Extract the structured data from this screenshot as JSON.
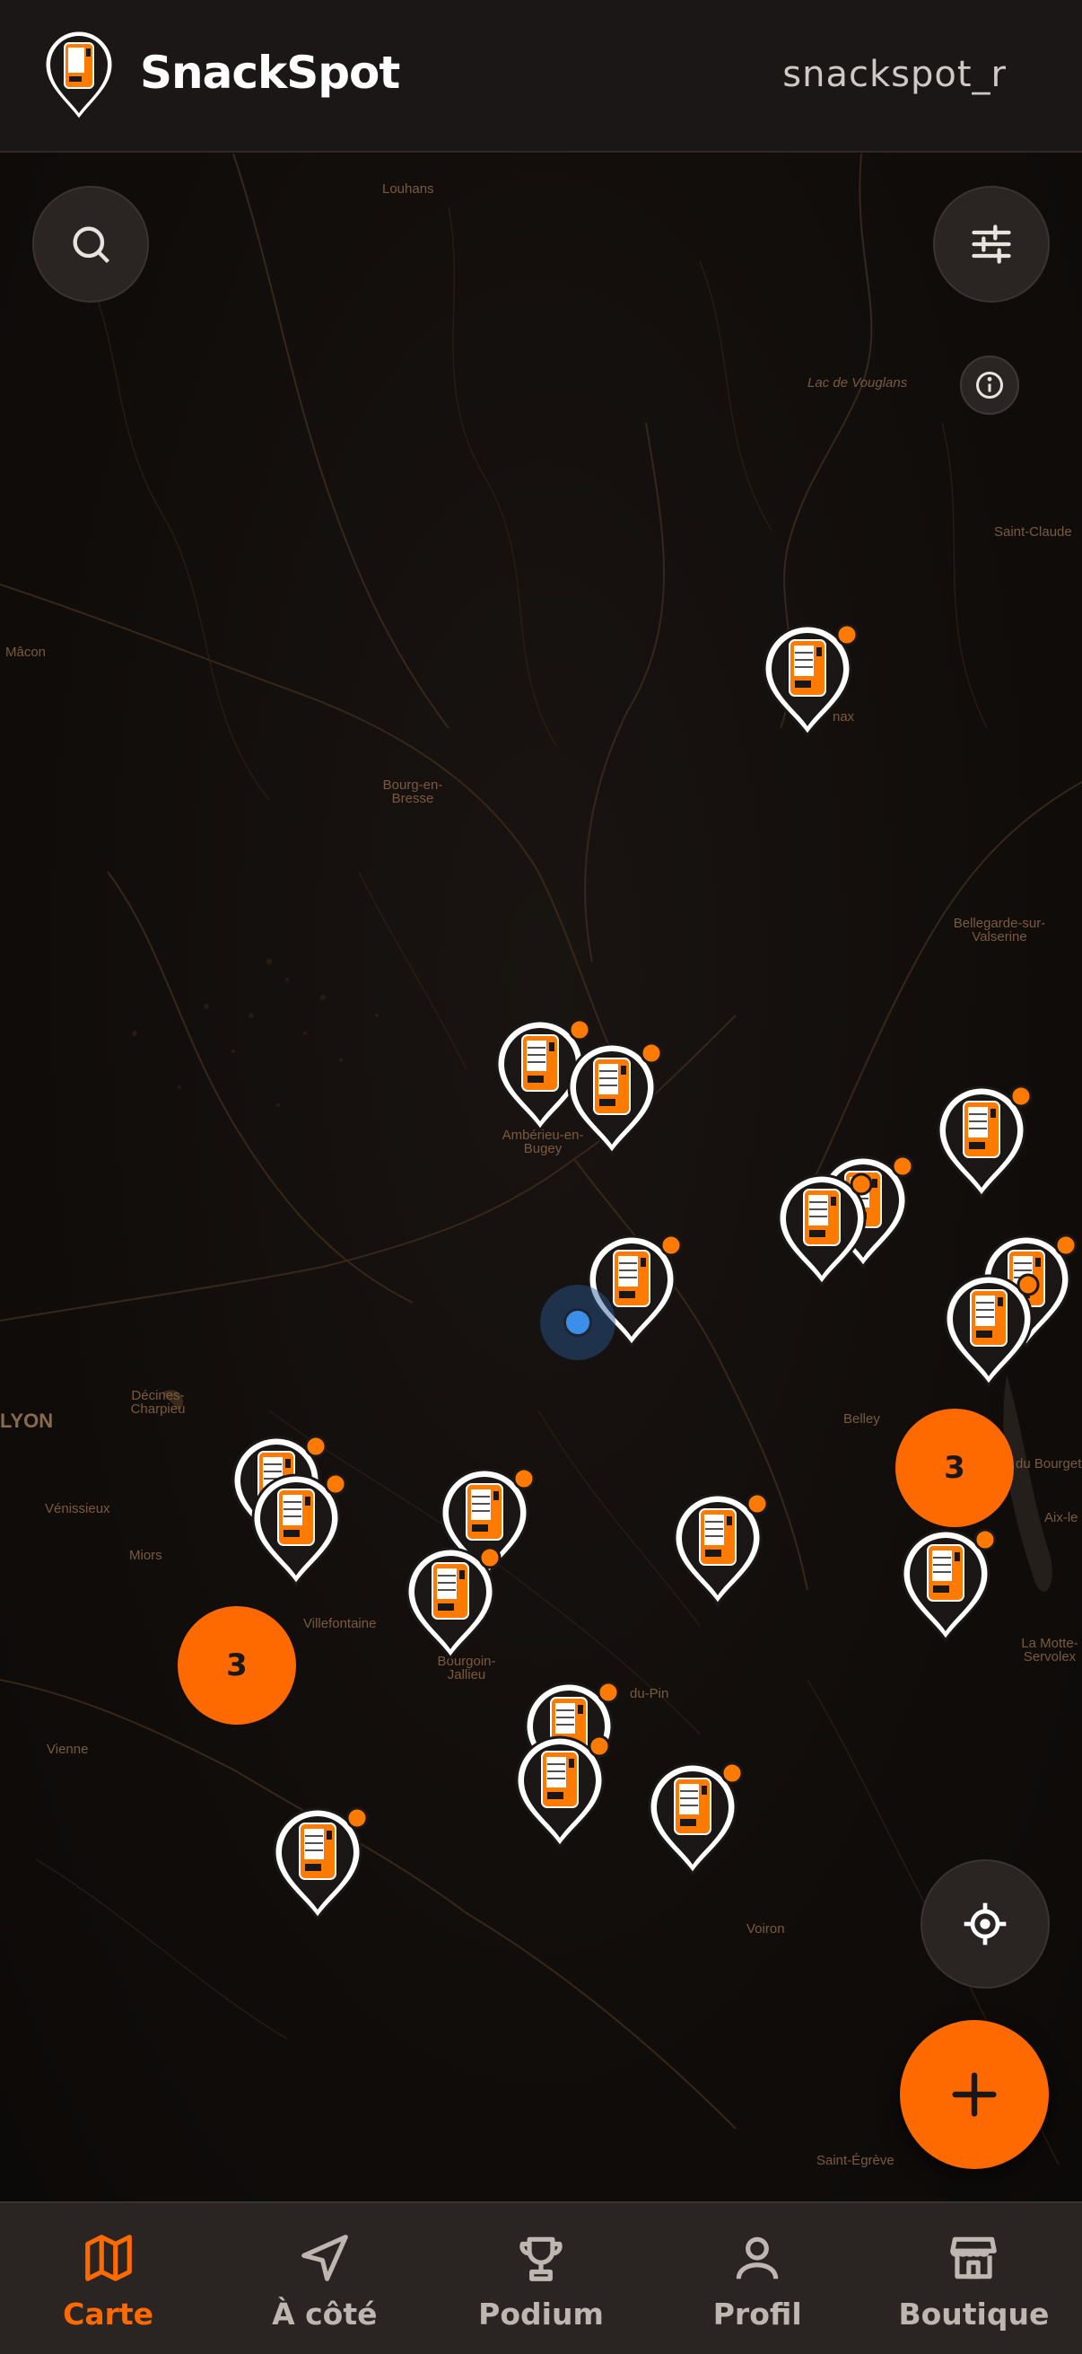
{
  "app": {
    "name": "SnackSpot",
    "username": "snackspot_r"
  },
  "map": {
    "places": [
      {
        "name": "Louhans"
      },
      {
        "name": "Lac de Vouglans"
      },
      {
        "name": "Saint-Claude"
      },
      {
        "name": "Mâcon"
      },
      {
        "name": "Bourg-en-Bresse"
      },
      {
        "name": "Bellegarde-sur-Valserine"
      },
      {
        "name": "Ambérieu-en-Bugey"
      },
      {
        "name": "Belley"
      },
      {
        "name": "LYON"
      },
      {
        "name": "Décines-Charpieu"
      },
      {
        "name": "Vénissieux"
      },
      {
        "name": "Miors"
      },
      {
        "name": "Villefontaine"
      },
      {
        "name": "Bourgoin-Jallieu"
      },
      {
        "name": "du-Pin"
      },
      {
        "name": "Vienne"
      },
      {
        "name": "Voiron"
      },
      {
        "name": "Saint-Égrève"
      },
      {
        "name": "Aix-le"
      },
      {
        "name": "La Motte-Servolex"
      },
      {
        "name": "du Bourget"
      },
      {
        "name": "nax"
      }
    ],
    "clusters": [
      {
        "count": "3"
      },
      {
        "count": "3"
      }
    ],
    "pin_icon": "vending-machine-pin-icon",
    "pin_color": "#ff7a00"
  },
  "controls": {
    "search": "search-icon",
    "filters": "sliders-icon",
    "info": "info-icon",
    "locate": "crosshair-icon",
    "add": "plus-icon"
  },
  "nav": [
    {
      "label": "Carte",
      "icon": "map-icon",
      "active": true
    },
    {
      "label": "À côté",
      "icon": "navigation-arrow-icon",
      "active": false
    },
    {
      "label": "Podium",
      "icon": "trophy-icon",
      "active": false
    },
    {
      "label": "Profil",
      "icon": "user-icon",
      "active": false
    },
    {
      "label": "Boutique",
      "icon": "store-icon",
      "active": false
    }
  ],
  "colors": {
    "accent": "#ff6a00",
    "header_bg": "#1b1716",
    "nav_bg": "#2a2523",
    "location": "#3b8fe8"
  }
}
